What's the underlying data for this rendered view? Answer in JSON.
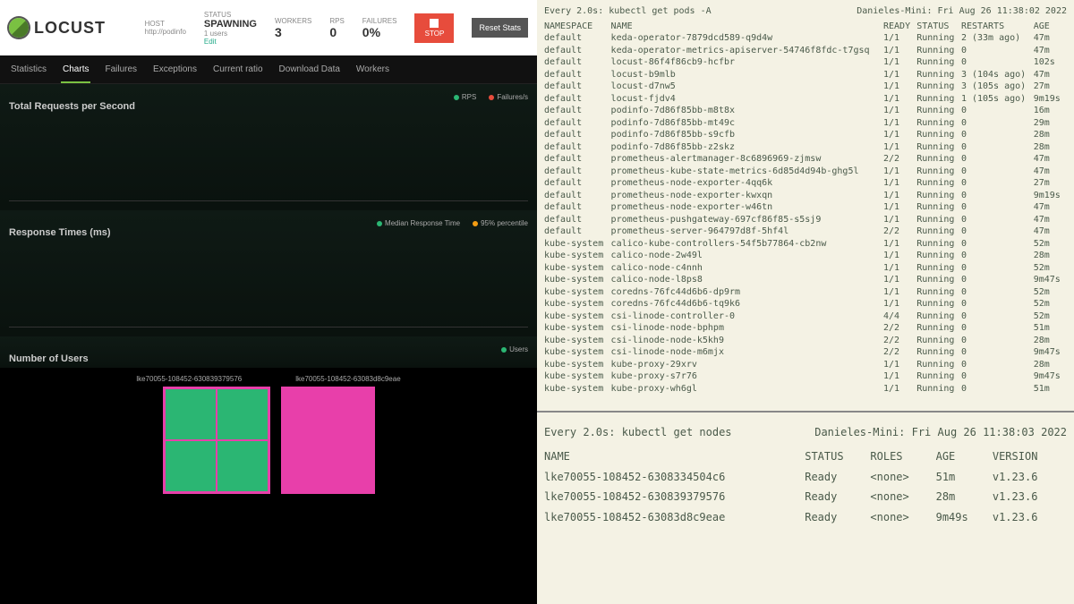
{
  "locust": {
    "brand": "LOCUST",
    "host_label": "HOST",
    "host_value": "http://podinfo",
    "status_label": "STATUS",
    "status_value": "SPAWNING",
    "status_sub": "1 users",
    "status_link": "Edit",
    "workers_label": "WORKERS",
    "workers_value": "3",
    "rps_label": "RPS",
    "rps_value": "0",
    "failures_label": "FAILURES",
    "failures_value": "0%",
    "stop_label": "STOP",
    "reset_label": "Reset Stats",
    "tabs": [
      "Statistics",
      "Charts",
      "Failures",
      "Exceptions",
      "Current ratio",
      "Download Data",
      "Workers"
    ],
    "chart1_title": "Total Requests per Second",
    "chart1_legend": [
      {
        "label": "RPS",
        "color": "#2bb673"
      },
      {
        "label": "Failures/s",
        "color": "#e74c3c"
      }
    ],
    "chart2_title": "Response Times (ms)",
    "chart2_legend": [
      {
        "label": "Median Response Time",
        "color": "#2bb673"
      },
      {
        "label": "95% percentile",
        "color": "#f39c12"
      }
    ],
    "chart3_title": "Number of Users",
    "chart3_legend": [
      {
        "label": "Users",
        "color": "#2bb673"
      }
    ],
    "thumbs": [
      "lke70055-108452-630839379576",
      "lke70055-108452-63083d8c9eae"
    ]
  },
  "term1": {
    "cmd": "Every 2.0s: kubectl get pods -A",
    "host": "Danieles-Mini: Fri Aug 26 11:38:02 2022",
    "headers": [
      "NAMESPACE",
      "NAME",
      "READY",
      "STATUS",
      "RESTARTS",
      "AGE"
    ],
    "rows": [
      [
        "default",
        "keda-operator-7879dcd589-q9d4w",
        "1/1",
        "Running",
        "2 (33m ago)",
        "47m"
      ],
      [
        "default",
        "keda-operator-metrics-apiserver-54746f8fdc-t7gsq",
        "1/1",
        "Running",
        "0",
        "47m"
      ],
      [
        "default",
        "locust-86f4f86cb9-hcfbr",
        "1/1",
        "Running",
        "0",
        "102s"
      ],
      [
        "default",
        "locust-b9mlb",
        "1/1",
        "Running",
        "3 (104s ago)",
        "47m"
      ],
      [
        "default",
        "locust-d7nw5",
        "1/1",
        "Running",
        "3 (105s ago)",
        "27m"
      ],
      [
        "default",
        "locust-fjdv4",
        "1/1",
        "Running",
        "1 (105s ago)",
        "9m19s"
      ],
      [
        "default",
        "podinfo-7d86f85bb-m8t8x",
        "1/1",
        "Running",
        "0",
        "16m"
      ],
      [
        "default",
        "podinfo-7d86f85bb-mt49c",
        "1/1",
        "Running",
        "0",
        "29m"
      ],
      [
        "default",
        "podinfo-7d86f85bb-s9cfb",
        "1/1",
        "Running",
        "0",
        "28m"
      ],
      [
        "default",
        "podinfo-7d86f85bb-z2skz",
        "1/1",
        "Running",
        "0",
        "28m"
      ],
      [
        "default",
        "prometheus-alertmanager-8c6896969-zjmsw",
        "2/2",
        "Running",
        "0",
        "47m"
      ],
      [
        "default",
        "prometheus-kube-state-metrics-6d85d4d94b-ghg5l",
        "1/1",
        "Running",
        "0",
        "47m"
      ],
      [
        "default",
        "prometheus-node-exporter-4qq6k",
        "1/1",
        "Running",
        "0",
        "27m"
      ],
      [
        "default",
        "prometheus-node-exporter-kwxqn",
        "1/1",
        "Running",
        "0",
        "9m19s"
      ],
      [
        "default",
        "prometheus-node-exporter-w46tn",
        "1/1",
        "Running",
        "0",
        "47m"
      ],
      [
        "default",
        "prometheus-pushgateway-697cf86f85-s5sj9",
        "1/1",
        "Running",
        "0",
        "47m"
      ],
      [
        "default",
        "prometheus-server-964797d8f-5hf4l",
        "2/2",
        "Running",
        "0",
        "47m"
      ],
      [
        "kube-system",
        "calico-kube-controllers-54f5b77864-cb2nw",
        "1/1",
        "Running",
        "0",
        "52m"
      ],
      [
        "kube-system",
        "calico-node-2w49l",
        "1/1",
        "Running",
        "0",
        "28m"
      ],
      [
        "kube-system",
        "calico-node-c4nnh",
        "1/1",
        "Running",
        "0",
        "52m"
      ],
      [
        "kube-system",
        "calico-node-l8ps8",
        "1/1",
        "Running",
        "0",
        "9m47s"
      ],
      [
        "kube-system",
        "coredns-76fc44d6b6-dp9rm",
        "1/1",
        "Running",
        "0",
        "52m"
      ],
      [
        "kube-system",
        "coredns-76fc44d6b6-tq9k6",
        "1/1",
        "Running",
        "0",
        "52m"
      ],
      [
        "kube-system",
        "csi-linode-controller-0",
        "4/4",
        "Running",
        "0",
        "52m"
      ],
      [
        "kube-system",
        "csi-linode-node-bphpm",
        "2/2",
        "Running",
        "0",
        "51m"
      ],
      [
        "kube-system",
        "csi-linode-node-k5kh9",
        "2/2",
        "Running",
        "0",
        "28m"
      ],
      [
        "kube-system",
        "csi-linode-node-m6mjx",
        "2/2",
        "Running",
        "0",
        "9m47s"
      ],
      [
        "kube-system",
        "kube-proxy-29xrv",
        "1/1",
        "Running",
        "0",
        "28m"
      ],
      [
        "kube-system",
        "kube-proxy-s7r76",
        "1/1",
        "Running",
        "0",
        "9m47s"
      ],
      [
        "kube-system",
        "kube-proxy-wh6gl",
        "1/1",
        "Running",
        "0",
        "51m"
      ]
    ]
  },
  "term2": {
    "cmd": "Every 2.0s: kubectl get nodes",
    "host": "Danieles-Mini: Fri Aug 26 11:38:03 2022",
    "headers": [
      "NAME",
      "STATUS",
      "ROLES",
      "AGE",
      "VERSION"
    ],
    "rows": [
      [
        "lke70055-108452-6308334504c6",
        "Ready",
        "<none>",
        "51m",
        "v1.23.6"
      ],
      [
        "lke70055-108452-630839379576",
        "Ready",
        "<none>",
        "28m",
        "v1.23.6"
      ],
      [
        "lke70055-108452-63083d8c9eae",
        "Ready",
        "<none>",
        "9m49s",
        "v1.23.6"
      ]
    ]
  }
}
